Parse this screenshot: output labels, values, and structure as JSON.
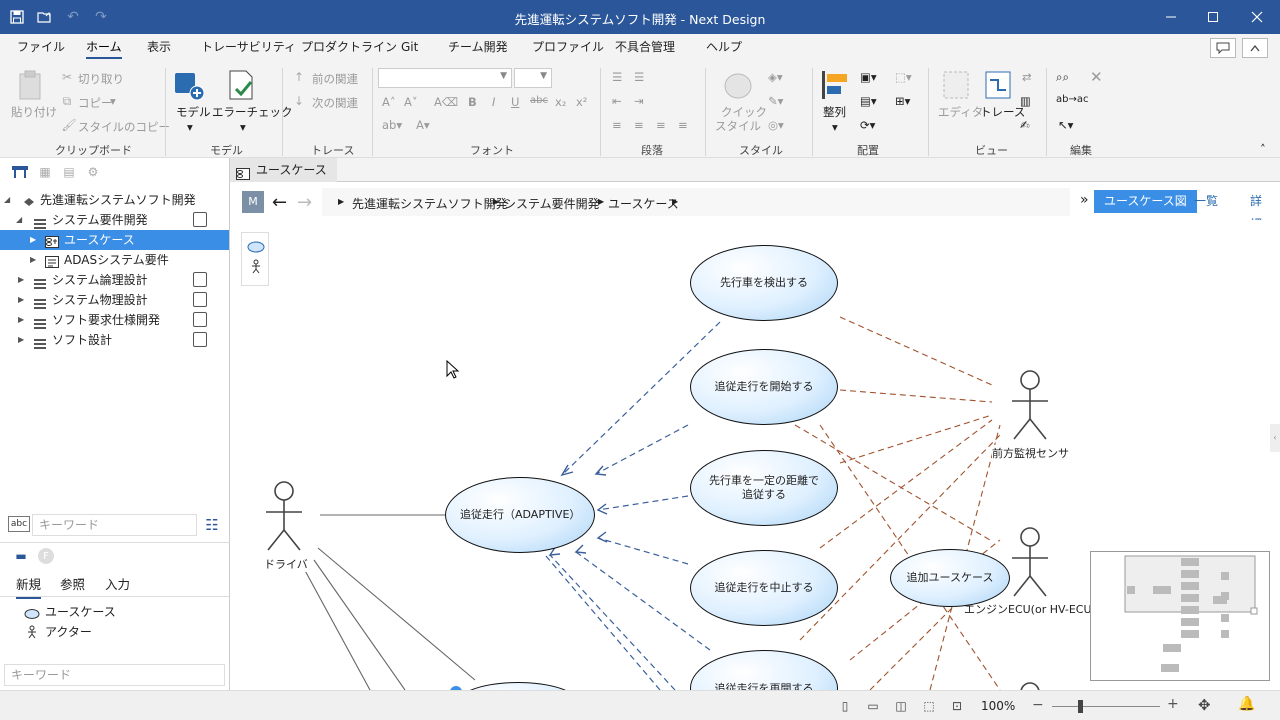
{
  "window": {
    "title": "先進運転システムソフト開発 - Next Design"
  },
  "menu": [
    {
      "label": "ファイル",
      "active": false
    },
    {
      "label": "ホーム",
      "active": true
    },
    {
      "label": "表示",
      "active": false
    },
    {
      "label": "トレーサビリティ",
      "active": false
    },
    {
      "label": "プロダクトライン",
      "active": false
    },
    {
      "label": "Git",
      "active": false
    },
    {
      "label": "チーム開発",
      "active": false
    },
    {
      "label": "プロファイル",
      "active": false
    },
    {
      "label": "不具合管理",
      "active": false
    },
    {
      "label": "ヘルプ",
      "active": false
    }
  ],
  "ribbon": {
    "clipboard": {
      "paste": "貼り付け",
      "cut": "切り取り",
      "copy": "コピー",
      "style_copy": "スタイルのコピー",
      "group": "クリップボード"
    },
    "model": {
      "model": "モデル",
      "error_check": "エラーチェック",
      "group": "モデル"
    },
    "trace": {
      "prev": "前の関連",
      "next": "次の関連",
      "group": "トレース"
    },
    "font": {
      "group": "フォント"
    },
    "paragraph": {
      "group": "段落"
    },
    "style": {
      "quick_style_1": "クイック",
      "quick_style_2": "スタイル",
      "group": "スタイル"
    },
    "arrange": {
      "align": "整列",
      "group": "配置"
    },
    "view": {
      "editor": "エディタ",
      "trace": "トレース",
      "group": "ビュー"
    },
    "edit": {
      "group": "編集"
    }
  },
  "tree": {
    "root": "先進運転システムソフト開発",
    "items": [
      {
        "label": "システム要件開発",
        "level": 1,
        "expanded": true
      },
      {
        "label": "ユースケース",
        "level": 2,
        "selected": true
      },
      {
        "label": "ADASシステム要件",
        "level": 2
      },
      {
        "label": "システム論理設計",
        "level": 1
      },
      {
        "label": "システム物理設計",
        "level": 1
      },
      {
        "label": "ソフト要求仕様開発",
        "level": 1
      },
      {
        "label": "ソフト設計",
        "level": 1
      }
    ],
    "search_placeholder": "キーワード"
  },
  "palette": {
    "tabs": [
      "新規",
      "参照",
      "入力"
    ],
    "items": [
      "ユースケース",
      "アクター"
    ],
    "search_placeholder": "キーワード"
  },
  "editor": {
    "tab_label": "ユースケース",
    "mode_badge": "M",
    "breadcrumb": [
      "先進運転システムソフト開発",
      "システム要件開発",
      "ユースケース"
    ],
    "views": [
      "ユースケース図",
      "一覧",
      "詳細"
    ]
  },
  "diagram": {
    "use_cases": [
      "先行車を検出する",
      "追従走行を開始する",
      "先行車を一定の距離で追従する",
      "追従走行を中止する",
      "追従走行を再開する",
      "追従走行（ADAPTIVE）",
      "追加ユースケース"
    ],
    "actors": [
      "ドライバ",
      "前方監視センサ",
      "エンジンECU(or HV-ECU)"
    ]
  },
  "status": {
    "zoom": "100%"
  },
  "colors": {
    "accent": "#2b579a",
    "selection": "#3a8ee6",
    "include_line": "#3a5f9a",
    "assoc_line": "#a0522d"
  }
}
